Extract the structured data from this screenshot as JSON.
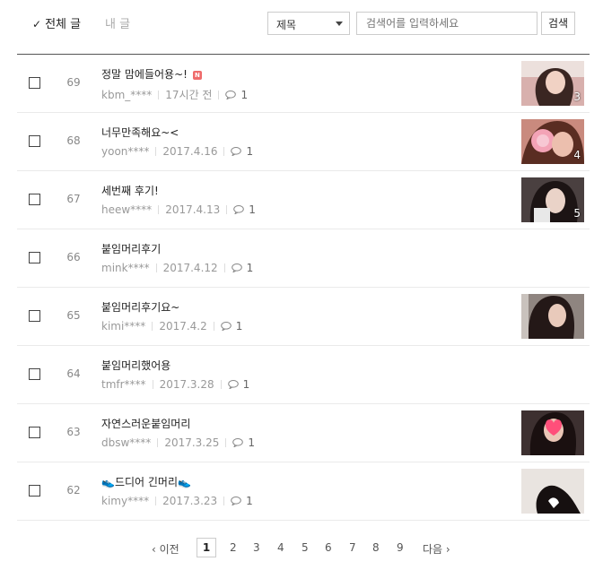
{
  "filters": {
    "all_label": "전체 글",
    "mine_label": "내 글"
  },
  "search": {
    "field_select": "제목",
    "placeholder": "검색어를 입력하세요",
    "button": "검색"
  },
  "posts": [
    {
      "num": "69",
      "title": "정말 맘에들어용~!",
      "new_badge": "N",
      "author": "kbm_****",
      "date": "17시간 전",
      "comments": "1",
      "thumb_count": "3"
    },
    {
      "num": "68",
      "title": "너무만족해요~<",
      "author": "yoon****",
      "date": "2017.4.16",
      "comments": "1",
      "thumb_count": "4"
    },
    {
      "num": "67",
      "title": "세번째 후기!",
      "author": "heew****",
      "date": "2017.4.13",
      "comments": "1",
      "thumb_count": "5"
    },
    {
      "num": "66",
      "title": "붙임머리후기",
      "author": "mink****",
      "date": "2017.4.12",
      "comments": "1"
    },
    {
      "num": "65",
      "title": "붙임머리후기요~",
      "author": "kimi****",
      "date": "2017.4.2",
      "comments": "1"
    },
    {
      "num": "64",
      "title": "붙임머리했어용",
      "author": "tmfr****",
      "date": "2017.3.28",
      "comments": "1"
    },
    {
      "num": "63",
      "title": "자연스러운붙임머리",
      "author": "dbsw****",
      "date": "2017.3.25",
      "comments": "1"
    },
    {
      "num": "62",
      "title": "👟드디어 긴머리👟",
      "author": "kimy****",
      "date": "2017.3.23",
      "comments": "1"
    }
  ],
  "pagination": {
    "prev": "이전",
    "next": "다음",
    "pages": [
      "1",
      "2",
      "3",
      "4",
      "5",
      "6",
      "7",
      "8",
      "9"
    ],
    "current": "1"
  }
}
